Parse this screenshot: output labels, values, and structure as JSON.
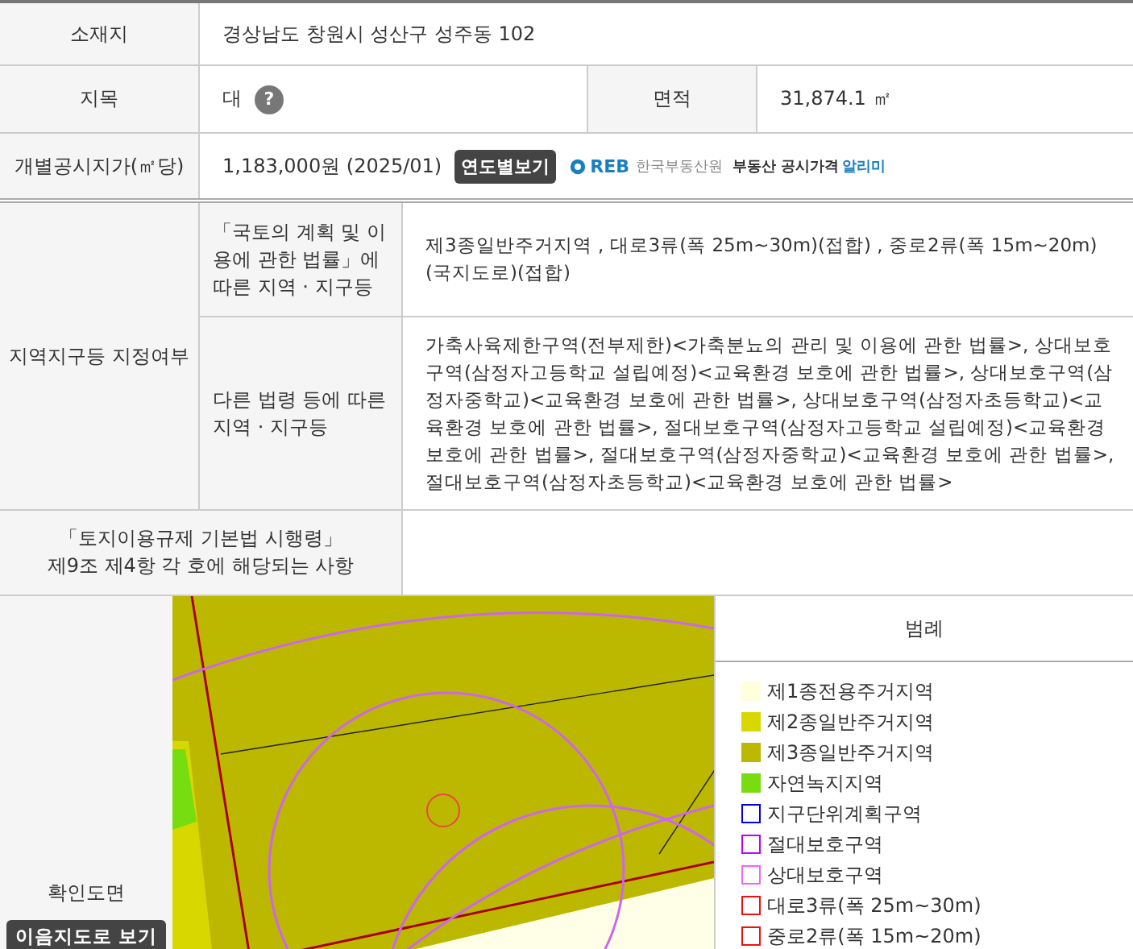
{
  "location": {
    "label": "소재지",
    "value": "경상남도 창원시 성산구 성주동 102"
  },
  "land_category": {
    "label": "지목",
    "value": "대",
    "help": "?"
  },
  "area": {
    "label": "면적",
    "value": "31,874.1 ㎡"
  },
  "official_price": {
    "label": "개별공시지가(㎡당)",
    "value": "1,183,000원 (2025/01)",
    "button": "연도별보기",
    "logo_mark": "REB",
    "logo_org": "한국부동산원",
    "logo_service": "부동산 공시가격",
    "logo_link": "알리미"
  },
  "zoning": {
    "label": "지역지구등 지정여부",
    "rows": [
      {
        "label": "「국토의 계획 및 이용에 관한 법률」에 따른 지역 · 지구등",
        "value": "제3종일반주거지역 , 대로3류(폭 25m~30m)(접합) , 중로2류(폭 15m~20m)(국지도로)(접합)"
      },
      {
        "label": "다른 법령 등에 따른 지역 · 지구등",
        "value": "가축사육제한구역(전부제한)<가축분뇨의 관리 및 이용에 관한 법률>, 상대보호구역(삼정자고등학교 설립예정)<교육환경 보호에 관한 법률>, 상대보호구역(삼정자중학교)<교육환경 보호에 관한 법률>, 상대보호구역(삼정자초등학교)<교육환경 보호에 관한 법률>, 절대보호구역(삼정자고등학교 설립예정)<교육환경 보호에 관한 법률>, 절대보호구역(삼정자중학교)<교육환경 보호에 관한 법률>, 절대보호구역(삼정자초등학교)<교육환경 보호에 관한 법률>"
      }
    ]
  },
  "enforcement": {
    "label_lines": [
      "「토지이용규제 기본법 시행령」",
      "제9조 제4항 각 호에 해당되는 사항"
    ]
  },
  "map": {
    "label": "확인도면",
    "button": "이음지도로 보기",
    "legend_title": "범례",
    "legend": [
      {
        "kind": "fill",
        "color": "#ffffdd",
        "label": "제1종전용주거지역"
      },
      {
        "kind": "fill",
        "color": "#d8d800",
        "label": "제2종일반주거지역"
      },
      {
        "kind": "fill",
        "color": "#bcb800",
        "label": "제3종일반주거지역"
      },
      {
        "kind": "fill",
        "color": "#77dd11",
        "label": "자연녹지지역"
      },
      {
        "kind": "outline",
        "color": "#0000ee",
        "label": "지구단위계획구역"
      },
      {
        "kind": "outline",
        "color": "#bb00ff",
        "label": "절대보호구역"
      },
      {
        "kind": "outline",
        "color": "#ee66ff",
        "label": "상대보호구역"
      },
      {
        "kind": "outline",
        "color": "#ee1111",
        "label": "대로3류(폭 25m~30m)"
      },
      {
        "kind": "outline",
        "color": "#ee1111",
        "label": "중로2류(폭 15m~20m)"
      }
    ]
  }
}
